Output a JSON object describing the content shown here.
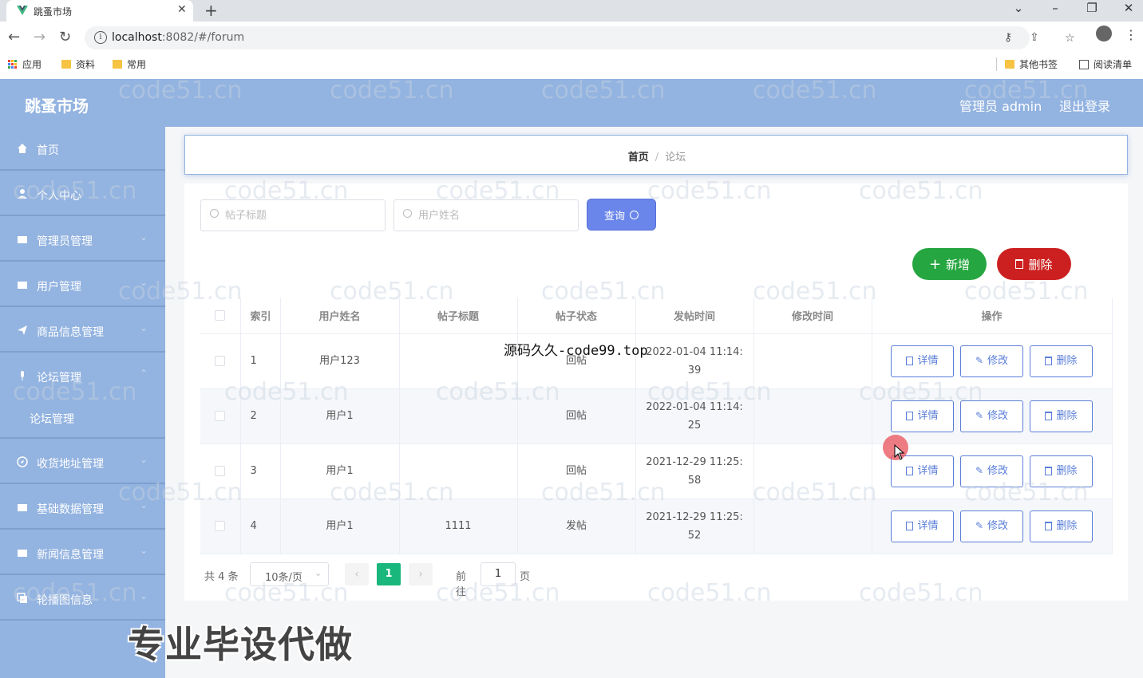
{
  "browser": {
    "tab_title": "跳蚤市场",
    "url_host": "localhost",
    "url_rest": ":8082/#/forum",
    "bookmarks": [
      "应用",
      "资料",
      "常用"
    ],
    "bookmarks_right": [
      "其他书签",
      "阅读清单"
    ]
  },
  "header": {
    "brand": "跳蚤市场",
    "admin": "管理员 admin",
    "logout": "退出登录"
  },
  "sidebar": {
    "items": [
      {
        "label": "首页",
        "icon": "home-icon"
      },
      {
        "label": "个人中心",
        "icon": "user-icon"
      },
      {
        "label": "管理员管理",
        "icon": "folder-icon"
      },
      {
        "label": "用户管理",
        "icon": "folder-icon"
      },
      {
        "label": "商品信息管理",
        "icon": "send-icon"
      },
      {
        "label": "论坛管理",
        "icon": "mic-icon"
      },
      {
        "label": "收货地址管理",
        "icon": "compass-icon"
      },
      {
        "label": "基础数据管理",
        "icon": "folder-icon"
      },
      {
        "label": "新闻信息管理",
        "icon": "folder-icon"
      },
      {
        "label": "轮播图信息",
        "icon": "copy-icon"
      }
    ],
    "sub_item": "论坛管理"
  },
  "breadcrumb": {
    "home": "首页",
    "sep": "/",
    "current": "论坛"
  },
  "search": {
    "title_placeholder": "帖子标题",
    "name_placeholder": "用户姓名",
    "query_label": "查询"
  },
  "actions": {
    "add_label": "新增",
    "delete_label": "删除"
  },
  "table": {
    "columns": [
      "索引",
      "用户姓名",
      "帖子标题",
      "帖子状态",
      "发帖时间",
      "修改时间",
      "操作"
    ],
    "rows": [
      {
        "index": "1",
        "user": "用户123",
        "title": "",
        "status": "回帖",
        "time_a": "2022-01-04 11:14:",
        "time_b": "39",
        "modified": ""
      },
      {
        "index": "2",
        "user": "用户1",
        "title": "",
        "status": "回帖",
        "time_a": "2022-01-04 11:14:",
        "time_b": "25",
        "modified": ""
      },
      {
        "index": "3",
        "user": "用户1",
        "title": "",
        "status": "回帖",
        "time_a": "2021-12-29 11:25:",
        "time_b": "58",
        "modified": ""
      },
      {
        "index": "4",
        "user": "用户1",
        "title": "1111",
        "status": "发帖",
        "time_a": "2021-12-29 11:25:",
        "time_b": "52",
        "modified": ""
      }
    ],
    "op_detail": "详情",
    "op_edit": "修改",
    "op_delete": "删除"
  },
  "pagination": {
    "total": "共 4 条",
    "page_size": "10条/页",
    "current": "1",
    "goto_label": "前往",
    "goto_value": "1",
    "page_suffix": "页"
  },
  "overlays": {
    "watermark": "code51.cn",
    "center_text": "源码久久-code99.top",
    "bottom_text": "专业毕设代做"
  },
  "colors": {
    "header_bg": "#93b3e0",
    "primary": "#6a86ea",
    "success": "#26a640",
    "danger": "#cc2020",
    "pager_active": "#19b77b"
  }
}
